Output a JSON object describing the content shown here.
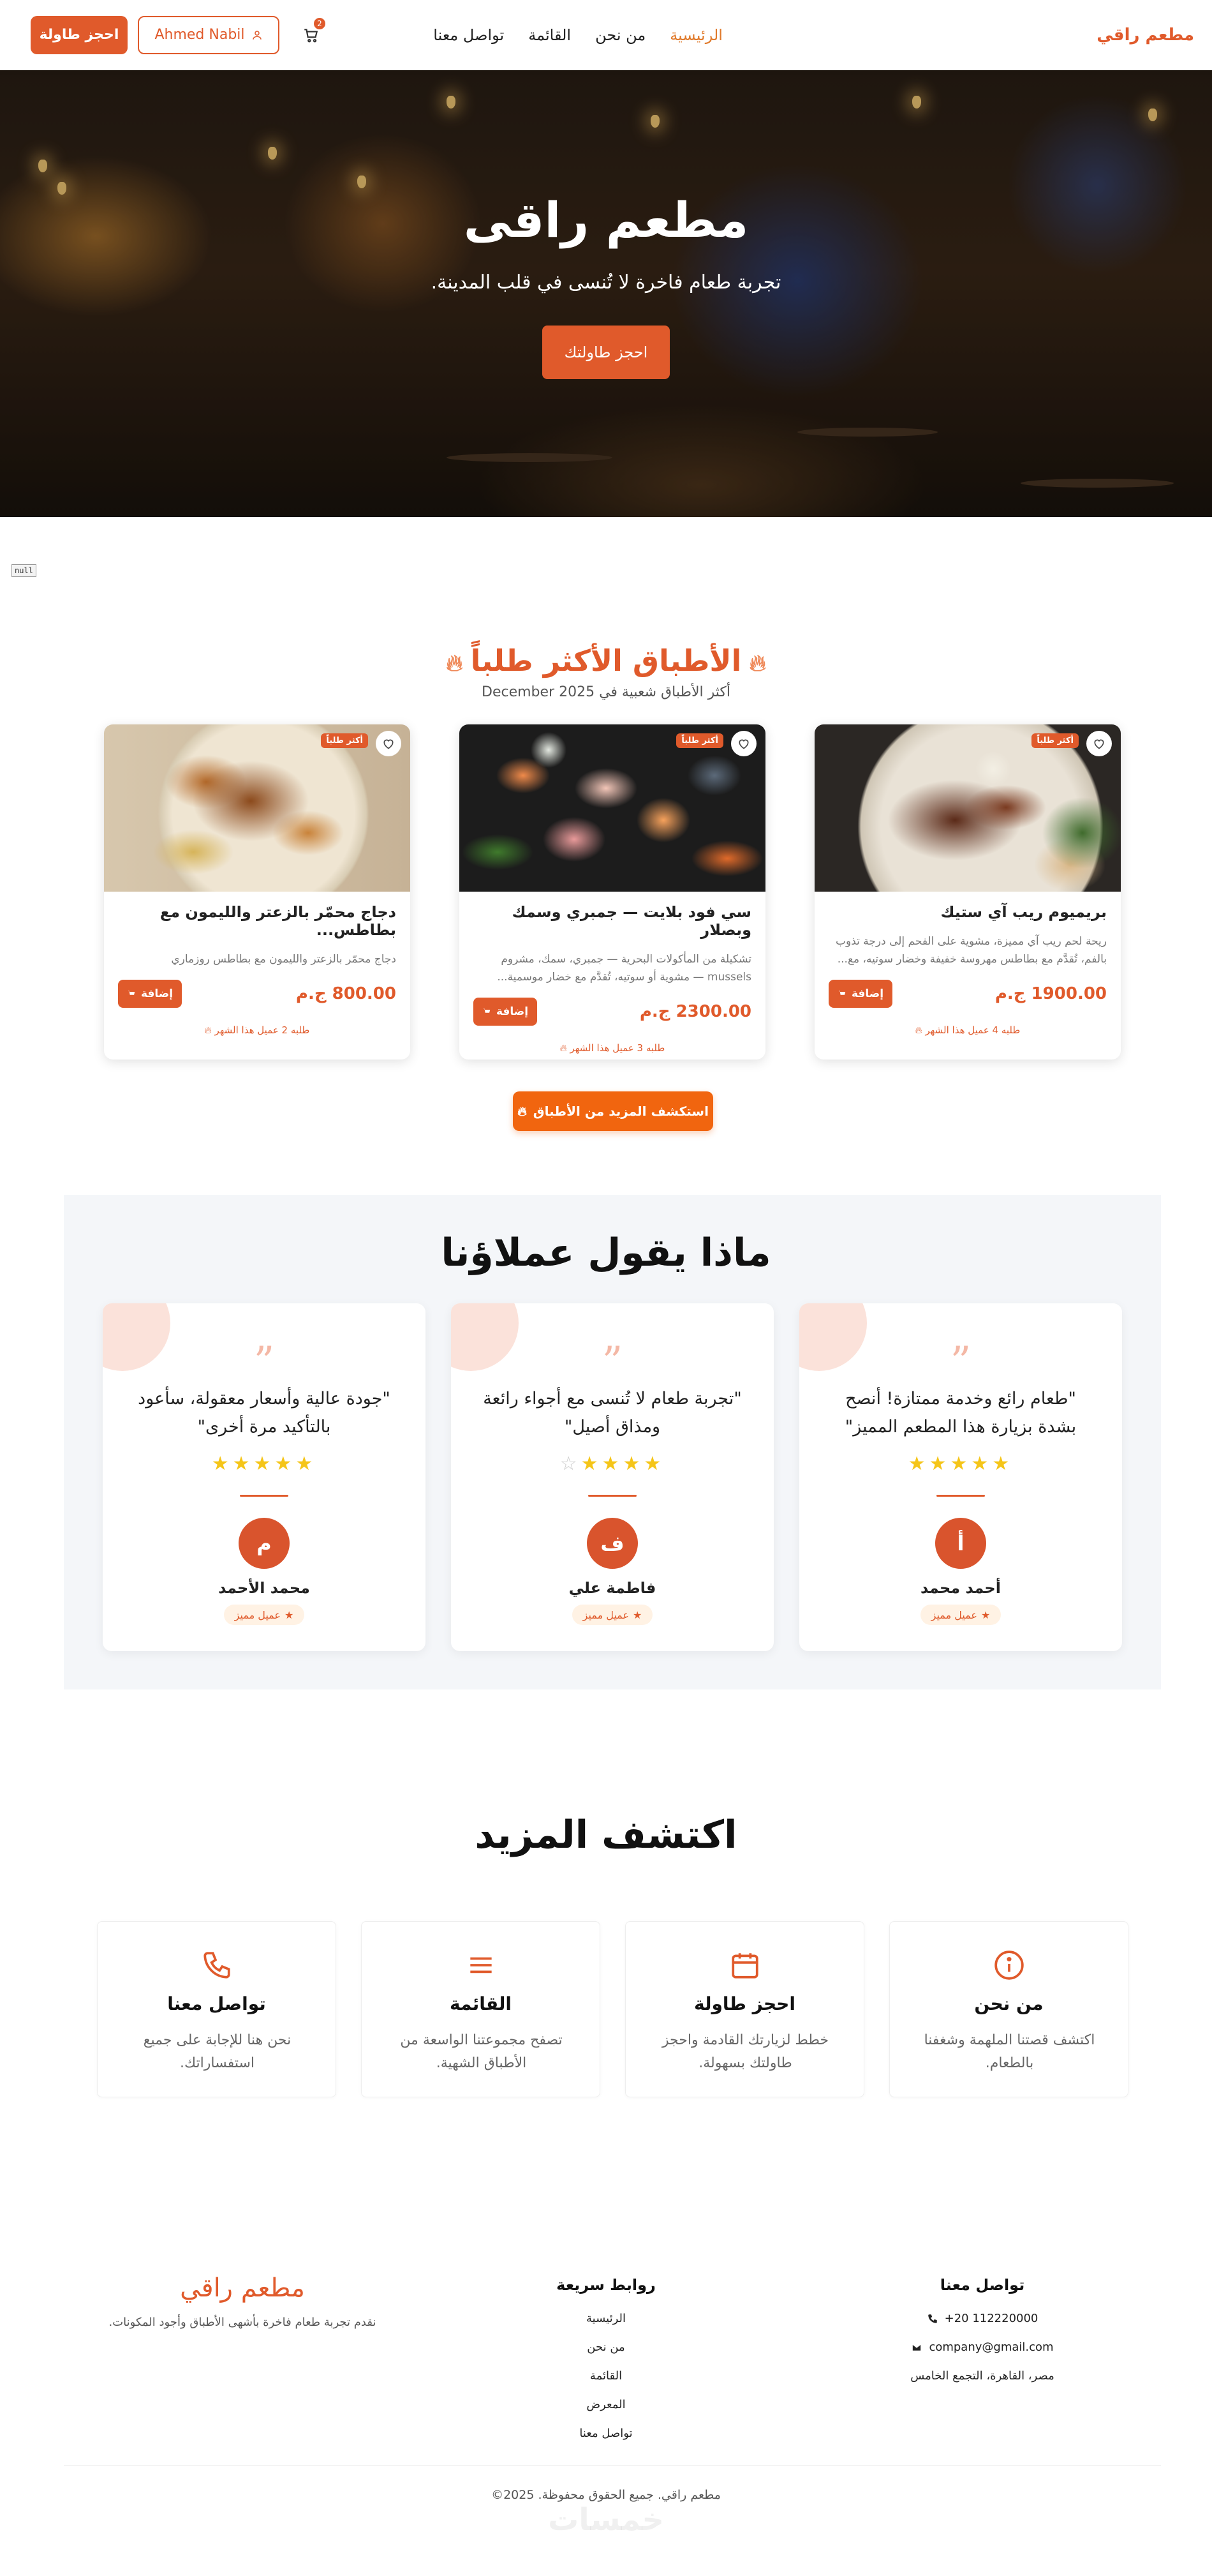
{
  "nav": {
    "brand": "مطعم راقي",
    "links": [
      "الرئيسية",
      "من نحن",
      "القائمة",
      "تواصل معنا"
    ],
    "user_label": "Ahmed Nabil",
    "cart_count": "2",
    "book_label": "احجز طاولة"
  },
  "hero": {
    "title": "مطعم راقى",
    "subtitle": "تجربة طعام فاخرة لا تُنسى في قلب المدينة.",
    "button": "احجز طاولتك"
  },
  "null_label": "null",
  "popular": {
    "title": "الأطباق الأكثر طلباً",
    "subtitle": "أكثر الأطباق شعبية في December 2025",
    "badge": "أكثر طلباً",
    "add_label": "إضافة",
    "dishes": [
      {
        "name": "بريميوم ريب آي ستيك",
        "desc": "ريحة لحم ريب آي مميزة، مشوية على الفحم إلى درجة تذوب بالفم، تُقدَّم مع بطاطس مهروسة خفيفة وخضار سوتيه، مع...",
        "price": "1900.00 ج.م",
        "orders": "طلبه 4 عميل هذا الشهر"
      },
      {
        "name": "سي فود بلايت — جمبري وسمك وبصلار",
        "desc": "تشكيلة من المأكولات البحرية — جمبري، سمك، مشروم mussels — مشوية أو سوتيه، تُقدَّم مع خضار موسمية...",
        "price": "2300.00 ج.م",
        "orders": "طلبه 3 عميل هذا الشهر"
      },
      {
        "name": "دجاج محمّر بالزعتر والليمون مع بطاطس...",
        "desc": "دجاج محمّر بالزعتر والليمون مع بطاطس روزماري",
        "price": "800.00 ج.م",
        "orders": "طلبه 2 عميل هذا الشهر"
      }
    ],
    "explore_button": "استكشف المزيد من الأطباق"
  },
  "testimonials": {
    "title": "ماذا يقول عملاؤنا",
    "badge": "عميل مميز",
    "items": [
      {
        "text": "\"طعام رائع وخدمة ممتازة! أنصح بشدة بزيارة هذا المطعم المميز\"",
        "name": "أحمد محمد",
        "initial": "أ",
        "rating": 5
      },
      {
        "text": "\"تجربة طعام لا تُنسى مع أجواء رائعة ومذاق أصيل\"",
        "name": "فاطمة علي",
        "initial": "ف",
        "rating": 4
      },
      {
        "text": "\"جودة عالية وأسعار معقولة، سأعود بالتأكيد مرة أخرى\"",
        "name": "محمد الأحمد",
        "initial": "م",
        "rating": 5
      }
    ]
  },
  "more": {
    "title": "اكتشف المزيد",
    "cards": [
      {
        "title": "من نحن",
        "desc": "اكتشف قصتنا الملهمة وشغفنا بالطعام.",
        "icon": "info-icon"
      },
      {
        "title": "احجز طاولة",
        "desc": "خطط لزيارتك القادمة واحجز طاولتك بسهولة.",
        "icon": "calendar-icon"
      },
      {
        "title": "القائمة",
        "desc": "تصفح مجموعتنا الواسعة من الأطباق الشهية.",
        "icon": "menu-icon"
      },
      {
        "title": "تواصل معنا",
        "desc": "نحن هنا للإجابة على جميع استفساراتك.",
        "icon": "phone-icon"
      }
    ]
  },
  "footer": {
    "contact_title": "تواصل معنا",
    "phone": "+20 112220000",
    "email": "company@gmail.com",
    "address": "مصر، القاهرة، التجمع الخامس",
    "links_title": "روابط سريعة",
    "links": [
      "الرئيسية",
      "من نحن",
      "القائمة",
      "المعرض",
      "تواصل معنا"
    ],
    "brand": "مطعم راقي",
    "about": "نقدم تجربة طعام فاخرة بأشهى الأطباق وأجود المكونات.",
    "copyright": "مطعم راقي. جميع الحقوق محفوظة. 2025©"
  },
  "colors": {
    "accent": "#e05a2b",
    "orange": "#f1650f",
    "star": "#f5c518"
  }
}
